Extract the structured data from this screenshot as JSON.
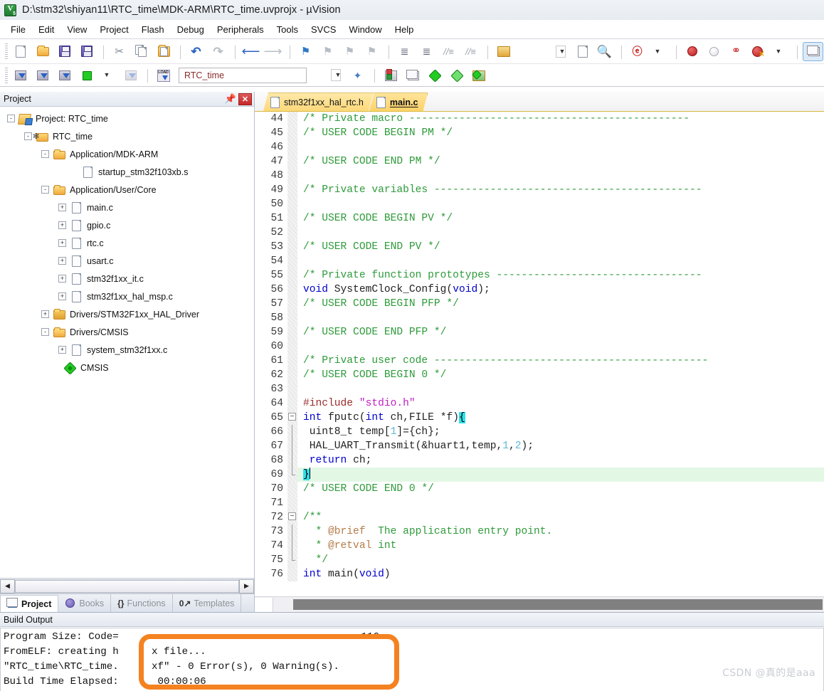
{
  "window": {
    "title": "D:\\stm32\\shiyan11\\RTC_time\\MDK-ARM\\RTC_time.uvprojx - µVision",
    "app_icon": "uvision-logo-icon"
  },
  "menubar": {
    "items": [
      {
        "label": "File"
      },
      {
        "label": "Edit"
      },
      {
        "label": "View"
      },
      {
        "label": "Project"
      },
      {
        "label": "Flash"
      },
      {
        "label": "Debug"
      },
      {
        "label": "Peripherals"
      },
      {
        "label": "Tools"
      },
      {
        "label": "SVCS"
      },
      {
        "label": "Window"
      },
      {
        "label": "Help"
      }
    ]
  },
  "toolbar_main": {
    "items": [
      {
        "name": "new-file-icon",
        "glyph": "page"
      },
      {
        "name": "open-file-icon",
        "glyph": "folder"
      },
      {
        "name": "save-icon",
        "glyph": "disk"
      },
      {
        "name": "save-all-icon",
        "glyph": "disk-multi"
      },
      {
        "name": "cut-icon",
        "glyph": "✂"
      },
      {
        "name": "copy-icon",
        "glyph": "copy"
      },
      {
        "name": "paste-icon",
        "glyph": "paste"
      },
      {
        "name": "undo-icon",
        "glyph": "↶"
      },
      {
        "name": "redo-icon",
        "glyph": "↷"
      },
      {
        "name": "navigate-back-icon",
        "glyph": "←"
      },
      {
        "name": "navigate-forward-icon",
        "glyph": "→"
      },
      {
        "name": "bookmark-toggle-icon",
        "glyph": "flag"
      },
      {
        "name": "bookmark-prev-icon",
        "glyph": "flag"
      },
      {
        "name": "bookmark-next-icon",
        "glyph": "flag"
      },
      {
        "name": "bookmark-clear-icon",
        "glyph": "flag"
      },
      {
        "name": "indent-right-icon",
        "glyph": "→|"
      },
      {
        "name": "indent-left-icon",
        "glyph": "|←"
      },
      {
        "name": "comment-lines-icon",
        "glyph": "//≡"
      },
      {
        "name": "uncomment-lines-icon",
        "glyph": "//≡"
      },
      {
        "name": "open-dialog-icon",
        "glyph": "bmp"
      },
      {
        "name": "source-browse-icon",
        "glyph": "doc-search"
      },
      {
        "name": "find-in-files-icon",
        "glyph": "binoculars"
      },
      {
        "name": "find-icon",
        "glyph": "find"
      },
      {
        "name": "insert-breakpoint-icon",
        "glyph": "red-dot"
      },
      {
        "name": "disable-breakpoint-icon",
        "glyph": "gray-dot"
      },
      {
        "name": "disable-all-breakpoints-icon",
        "glyph": "rings"
      },
      {
        "name": "kill-all-breakpoints-icon",
        "glyph": "red-x"
      },
      {
        "name": "manage-windows-icon",
        "glyph": "window"
      }
    ]
  },
  "toolbar_build": {
    "project_target": "RTC_time",
    "items": [
      {
        "name": "translate-icon"
      },
      {
        "name": "build-icon"
      },
      {
        "name": "rebuild-icon"
      },
      {
        "name": "batch-build-icon"
      },
      {
        "name": "stop-build-icon"
      },
      {
        "name": "download-icon",
        "glyph": "LOAD"
      },
      {
        "name": "target-options-icon"
      },
      {
        "name": "manage-project-items-icon"
      },
      {
        "name": "manage-runtime-env-icon"
      },
      {
        "name": "configure-flash-icon"
      },
      {
        "name": "pack-installer-icon"
      }
    ]
  },
  "project_panel": {
    "title": "Project",
    "pin_icon": "pin-icon",
    "close_icon": "close-icon",
    "tree": [
      {
        "label": "Project: RTC_time",
        "icon": "project-root-icon",
        "toggle": "-",
        "depth": 0
      },
      {
        "label": "RTC_time",
        "icon": "target-icon",
        "toggle": "-",
        "depth": 1
      },
      {
        "label": "Application/MDK-ARM",
        "icon": "group-folder-icon",
        "toggle": "-",
        "depth": 2
      },
      {
        "label": "startup_stm32f103xb.s",
        "icon": "source-file-icon",
        "toggle": "",
        "depth": 3
      },
      {
        "label": "Application/User/Core",
        "icon": "group-folder-icon",
        "toggle": "-",
        "depth": 2
      },
      {
        "label": "main.c",
        "icon": "source-file-icon",
        "toggle": "+",
        "depth": 3
      },
      {
        "label": "gpio.c",
        "icon": "source-file-icon",
        "toggle": "+",
        "depth": 3
      },
      {
        "label": "rtc.c",
        "icon": "source-file-icon",
        "toggle": "+",
        "depth": 3
      },
      {
        "label": "usart.c",
        "icon": "source-file-icon",
        "toggle": "+",
        "depth": 3
      },
      {
        "label": "stm32f1xx_it.c",
        "icon": "source-file-icon",
        "toggle": "+",
        "depth": 3
      },
      {
        "label": "stm32f1xx_hal_msp.c",
        "icon": "source-file-icon",
        "toggle": "+",
        "depth": 3
      },
      {
        "label": "Drivers/STM32F1xx_HAL_Driver",
        "icon": "group-folder-closed-icon",
        "toggle": "+",
        "depth": 2
      },
      {
        "label": "Drivers/CMSIS",
        "icon": "group-folder-icon",
        "toggle": "-",
        "depth": 2
      },
      {
        "label": "system_stm32f1xx.c",
        "icon": "source-file-icon",
        "toggle": "+",
        "depth": 3
      },
      {
        "label": "CMSIS",
        "icon": "cmsis-icon",
        "toggle": "",
        "depth": 2
      }
    ],
    "tabs": [
      {
        "label": "Project",
        "icon": "project-tab-icon",
        "active": true
      },
      {
        "label": "Books",
        "icon": "books-tab-icon",
        "active": false
      },
      {
        "label": "Functions",
        "icon": "functions-tab-icon",
        "active": false
      },
      {
        "label": "Templates",
        "icon": "templates-tab-icon",
        "active": false
      }
    ]
  },
  "editor": {
    "tabs": [
      {
        "label": "stm32f1xx_hal_rtc.h",
        "active": false,
        "icon": "file-icon"
      },
      {
        "label": "main.c",
        "active": true,
        "icon": "file-icon"
      }
    ],
    "first_line": 44,
    "lines": [
      {
        "n": 44,
        "fold": "",
        "tokens": [
          {
            "t": "/* Private macro ---------------------------------------------",
            "c": "cm"
          }
        ]
      },
      {
        "n": 45,
        "fold": "",
        "tokens": [
          {
            "t": "/* USER CODE BEGIN PM */",
            "c": "cm"
          }
        ]
      },
      {
        "n": 46,
        "fold": "",
        "tokens": []
      },
      {
        "n": 47,
        "fold": "",
        "tokens": [
          {
            "t": "/* USER CODE END PM */",
            "c": "cm"
          }
        ]
      },
      {
        "n": 48,
        "fold": "",
        "tokens": []
      },
      {
        "n": 49,
        "fold": "",
        "tokens": [
          {
            "t": "/* Private variables -------------------------------------------",
            "c": "cm"
          }
        ]
      },
      {
        "n": 50,
        "fold": "",
        "tokens": []
      },
      {
        "n": 51,
        "fold": "",
        "tokens": [
          {
            "t": "/* USER CODE BEGIN PV */",
            "c": "cm"
          }
        ]
      },
      {
        "n": 52,
        "fold": "",
        "tokens": []
      },
      {
        "n": 53,
        "fold": "",
        "tokens": [
          {
            "t": "/* USER CODE END PV */",
            "c": "cm"
          }
        ]
      },
      {
        "n": 54,
        "fold": "",
        "tokens": []
      },
      {
        "n": 55,
        "fold": "",
        "tokens": [
          {
            "t": "/* Private function prototypes ---------------------------------",
            "c": "cm"
          }
        ]
      },
      {
        "n": 56,
        "fold": "",
        "tokens": [
          {
            "t": "void",
            "c": "kw"
          },
          {
            "t": " SystemClock_Config(",
            "c": "pl"
          },
          {
            "t": "void",
            "c": "kw"
          },
          {
            "t": ");",
            "c": "pl"
          }
        ]
      },
      {
        "n": 57,
        "fold": "",
        "tokens": [
          {
            "t": "/* USER CODE BEGIN PFP */",
            "c": "cm"
          }
        ]
      },
      {
        "n": 58,
        "fold": "",
        "tokens": []
      },
      {
        "n": 59,
        "fold": "",
        "tokens": [
          {
            "t": "/* USER CODE END PFP */",
            "c": "cm"
          }
        ]
      },
      {
        "n": 60,
        "fold": "",
        "tokens": []
      },
      {
        "n": 61,
        "fold": "",
        "tokens": [
          {
            "t": "/* Private user code --------------------------------------------",
            "c": "cm"
          }
        ]
      },
      {
        "n": 62,
        "fold": "",
        "tokens": [
          {
            "t": "/* USER CODE BEGIN 0 */",
            "c": "cm"
          }
        ]
      },
      {
        "n": 63,
        "fold": "",
        "tokens": []
      },
      {
        "n": 64,
        "fold": "",
        "tokens": [
          {
            "t": "#include",
            "c": "pp"
          },
          {
            "t": " ",
            "c": "pl"
          },
          {
            "t": "\"stdio.h\"",
            "c": "str"
          }
        ]
      },
      {
        "n": 65,
        "fold": "minus",
        "tokens": [
          {
            "t": "int",
            "c": "kw"
          },
          {
            "t": " fputc(",
            "c": "pl"
          },
          {
            "t": "int",
            "c": "kw"
          },
          {
            "t": " ch,FILE *f)",
            "c": "pl"
          },
          {
            "t": "{",
            "c": "brc-hl"
          }
        ]
      },
      {
        "n": 66,
        "fold": "line",
        "tokens": [
          {
            "t": " uint8_t temp[",
            "c": "pl"
          },
          {
            "t": "1",
            "c": "num"
          },
          {
            "t": "]={ch};",
            "c": "pl"
          }
        ]
      },
      {
        "n": 67,
        "fold": "line",
        "tokens": [
          {
            "t": " HAL_UART_Transmit(&huart1,temp,",
            "c": "pl"
          },
          {
            "t": "1",
            "c": "num"
          },
          {
            "t": ",",
            "c": "pl"
          },
          {
            "t": "2",
            "c": "num"
          },
          {
            "t": ");",
            "c": "pl"
          }
        ]
      },
      {
        "n": 68,
        "fold": "line",
        "tokens": [
          {
            "t": " ",
            "c": "pl"
          },
          {
            "t": "return",
            "c": "kw"
          },
          {
            "t": " ch;",
            "c": "pl"
          }
        ]
      },
      {
        "n": 69,
        "fold": "end",
        "highlight": true,
        "caret": true,
        "tokens": [
          {
            "t": "}",
            "c": "brc-hl"
          }
        ]
      },
      {
        "n": 70,
        "fold": "",
        "tokens": [
          {
            "t": "/* USER CODE END 0 */",
            "c": "cm"
          }
        ]
      },
      {
        "n": 71,
        "fold": "",
        "tokens": []
      },
      {
        "n": 72,
        "fold": "minus",
        "tokens": [
          {
            "t": "/**",
            "c": "cm"
          }
        ]
      },
      {
        "n": 73,
        "fold": "line",
        "tokens": [
          {
            "t": "  * ",
            "c": "cm"
          },
          {
            "t": "@brief",
            "c": "doc"
          },
          {
            "t": "  The application entry point.",
            "c": "cm"
          }
        ]
      },
      {
        "n": 74,
        "fold": "line",
        "tokens": [
          {
            "t": "  * ",
            "c": "cm"
          },
          {
            "t": "@retval",
            "c": "doc"
          },
          {
            "t": " int",
            "c": "cm"
          }
        ]
      },
      {
        "n": 75,
        "fold": "end",
        "tokens": [
          {
            "t": "  */",
            "c": "cm"
          }
        ]
      },
      {
        "n": 76,
        "fold": "",
        "tokens": [
          {
            "t": "int",
            "c": "kw"
          },
          {
            "t": " main(",
            "c": "pl"
          },
          {
            "t": "void",
            "c": "kw"
          },
          {
            "t": ")",
            "c": "pl"
          }
        ]
      }
    ]
  },
  "build_output": {
    "title": "Build Output",
    "lines": [
      "Program Size: Code=                                        116",
      "FromELF: creating h",
      "\"RTC_time\\RTC_time.",
      "Build Time Elapsed:"
    ]
  },
  "annotation": {
    "accent_color": "#f58220",
    "lines": [
      "x file...",
      "xf\" - 0 Error(s), 0 Warning(s).",
      " 00:00:06"
    ]
  },
  "watermark": {
    "text": "CSDN @真的是aaa"
  }
}
